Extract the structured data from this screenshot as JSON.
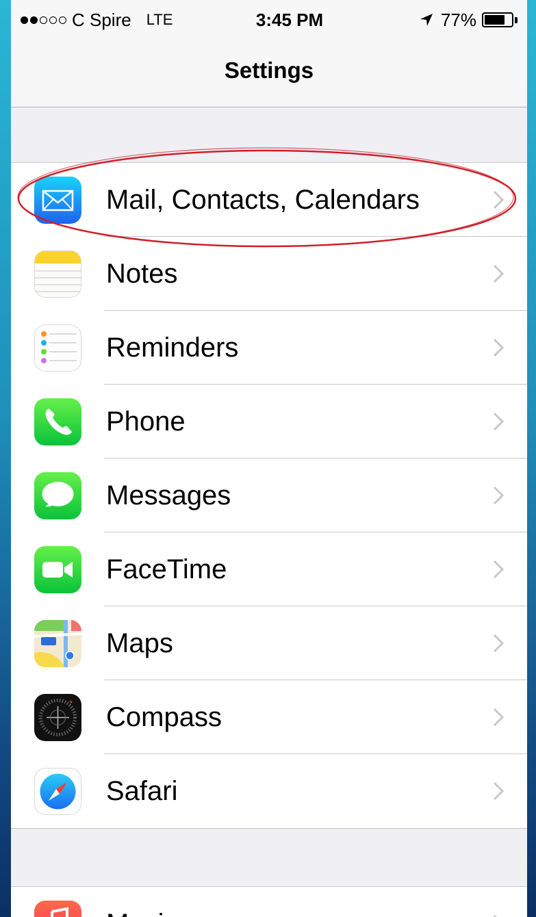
{
  "status_bar": {
    "signal_filled": 2,
    "signal_total": 5,
    "carrier": "C Spire",
    "network": "LTE",
    "time": "3:45 PM",
    "location_icon": "location-arrow-icon",
    "battery_percent_label": "77%",
    "battery_level": 0.77
  },
  "nav": {
    "title": "Settings"
  },
  "groups": [
    {
      "items": [
        {
          "label": "Mail, Contacts, Calendars",
          "icon": "mail-icon",
          "highlighted": true
        },
        {
          "label": "Notes",
          "icon": "notes-icon"
        },
        {
          "label": "Reminders",
          "icon": "reminders-icon"
        },
        {
          "label": "Phone",
          "icon": "phone-icon"
        },
        {
          "label": "Messages",
          "icon": "messages-icon"
        },
        {
          "label": "FaceTime",
          "icon": "facetime-icon"
        },
        {
          "label": "Maps",
          "icon": "maps-icon"
        },
        {
          "label": "Compass",
          "icon": "compass-icon"
        },
        {
          "label": "Safari",
          "icon": "safari-icon"
        }
      ]
    },
    {
      "items": [
        {
          "label": "Music",
          "icon": "music-icon"
        }
      ]
    }
  ],
  "colors": {
    "background_gradient_top": "#2ab6d6",
    "background_gradient_bottom": "#0b2f63",
    "highlight_ring": "#d0202a",
    "chevron": "#c7c7cc"
  }
}
